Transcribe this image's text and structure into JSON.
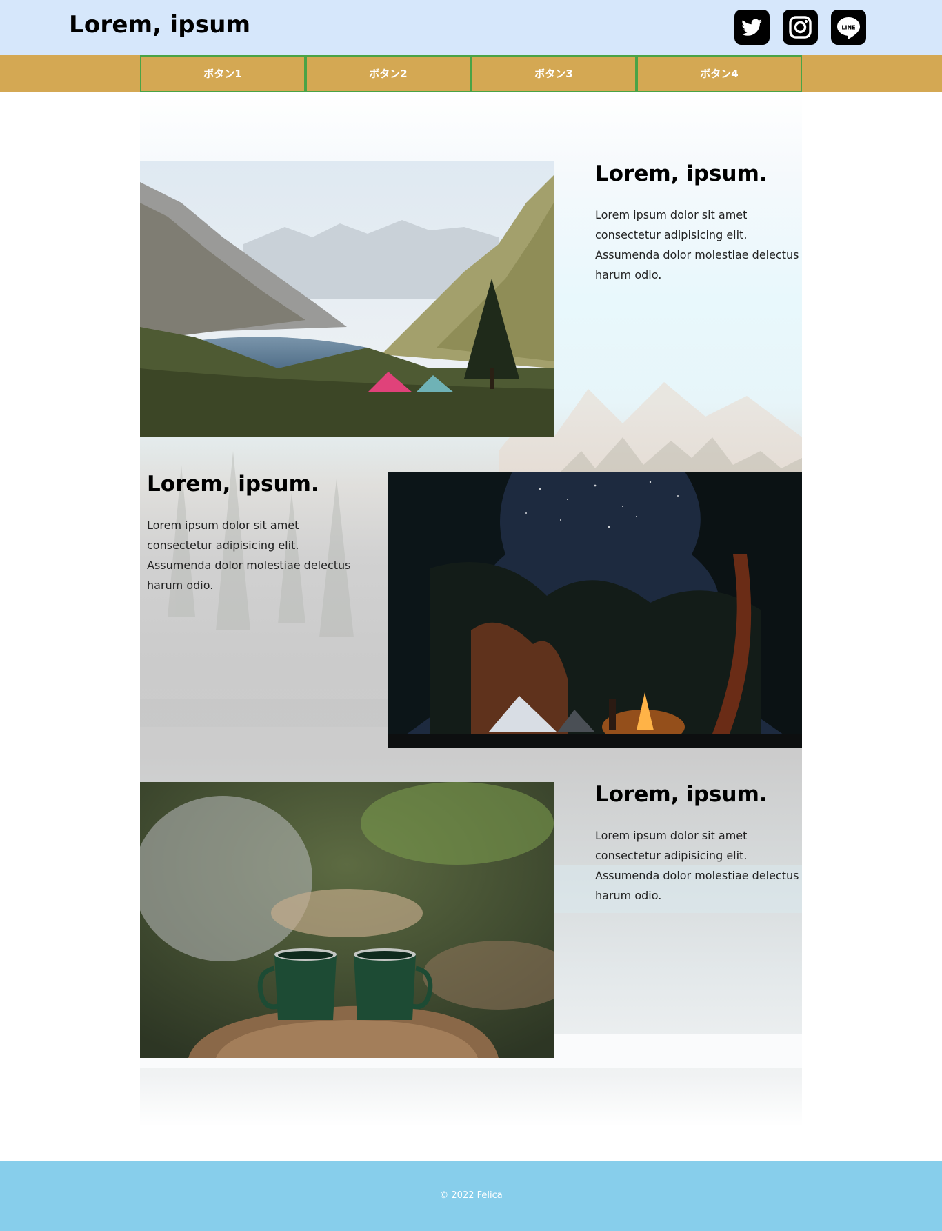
{
  "header": {
    "title": "Lorem, ipsum",
    "social": [
      {
        "icon": "twitter-icon"
      },
      {
        "icon": "instagram-icon"
      },
      {
        "icon": "line-icon",
        "label": "LINE"
      }
    ]
  },
  "nav": {
    "buttons": [
      "ボタン1",
      "ボタン2",
      "ボタン3",
      "ボタン4"
    ]
  },
  "sections": [
    {
      "title": "Lorem, ipsum.",
      "text": "Lorem ipsum dolor sit amet consectetur adipisicing elit. Assumenda dolor molestiae delectus harum odio.",
      "image": "mountain-lake-tents-photo"
    },
    {
      "title": "Lorem, ipsum.",
      "text": "Lorem ipsum dolor sit amet consectetur adipisicing elit. Assumenda dolor molestiae delectus harum odio.",
      "image": "night-campfire-forest-photo"
    },
    {
      "title": "Lorem, ipsum.",
      "text": "Lorem ipsum dolor sit amet consectetur adipisicing elit. Assumenda dolor molestiae delectus harum odio.",
      "image": "green-enamel-mugs-photo"
    }
  ],
  "footer": {
    "copyright": "© 2022 Felica"
  },
  "colors": {
    "header_bg": "#d6e7fb",
    "nav_bg": "#d4a853",
    "nav_border": "#4aa346",
    "footer_bg": "#87ceeb"
  }
}
